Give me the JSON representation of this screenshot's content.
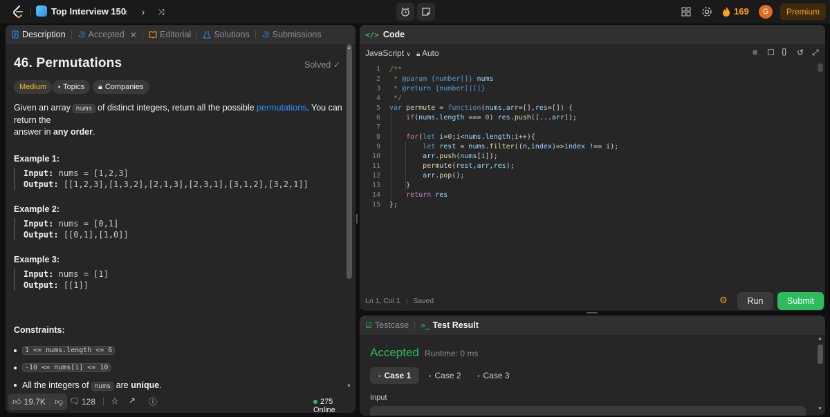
{
  "topbar": {
    "list_title": "Top Interview 150",
    "streak": "169",
    "avatar_letter": "G",
    "premium_label": "Premium"
  },
  "left_tabs": [
    {
      "label": "Description"
    },
    {
      "label": "Accepted"
    },
    {
      "label": "Editorial"
    },
    {
      "label": "Solutions"
    },
    {
      "label": "Submissions"
    }
  ],
  "problem": {
    "title": "46. Permutations",
    "status": "Solved",
    "difficulty": "Medium",
    "topics_label": "Topics",
    "companies_label": "Companies",
    "desc_1": "Given an array",
    "desc_code": "nums",
    "desc_2": "of distinct integers, return all the possible",
    "desc_link": "permutations",
    "desc_3": ". You can return the",
    "desc_4": "answer in",
    "desc_bold": "any order",
    "desc_5": ".",
    "examples": [
      {
        "heading": "Example 1:",
        "input_label": "Input:",
        "input": "nums = [1,2,3]",
        "output_label": "Output:",
        "output": "[[1,2,3],[1,3,2],[2,1,3],[2,3,1],[3,1,2],[3,2,1]]"
      },
      {
        "heading": "Example 2:",
        "input_label": "Input:",
        "input": "nums = [0,1]",
        "output_label": "Output:",
        "output": "[[0,1],[1,0]]"
      },
      {
        "heading": "Example 3:",
        "input_label": "Input:",
        "input": "nums = [1]",
        "output_label": "Output:",
        "output": "[[1]]"
      }
    ],
    "constraints_heading": "Constraints:",
    "constraint_1": "1 <= nums.length <= 6",
    "constraint_2": "-10 <= nums[i] <= 10",
    "constraint_3a": "All the integers of",
    "constraint_3code": "nums",
    "constraint_3b": "are",
    "constraint_3bold": "unique",
    "constraint_3c": "."
  },
  "footer": {
    "likes": "19.7K",
    "comments": "128",
    "online": "275 Online"
  },
  "code_panel": {
    "title": "Code",
    "language": "JavaScript",
    "mode": "Auto",
    "status_pos": "Ln 1, Col 1",
    "status_saved": "Saved",
    "run_label": "Run",
    "submit_label": "Submit"
  },
  "code_lines": [
    "1",
    "2",
    "3",
    "4",
    "5",
    "6",
    "7",
    "8",
    "9",
    "10",
    "11",
    "12",
    "13",
    "14",
    "15"
  ],
  "result_panel": {
    "tab_testcase": "Testcase",
    "tab_result": "Test Result",
    "verdict": "Accepted",
    "runtime": "Runtime: 0 ms",
    "cases": [
      "Case 1",
      "Case 2",
      "Case 3"
    ],
    "input_label": "Input"
  },
  "colors": {
    "accent_green": "#2cbb5d",
    "accent_orange": "#ffa116",
    "link_blue": "#2f8fff",
    "medium_yellow": "#ffc01e"
  }
}
